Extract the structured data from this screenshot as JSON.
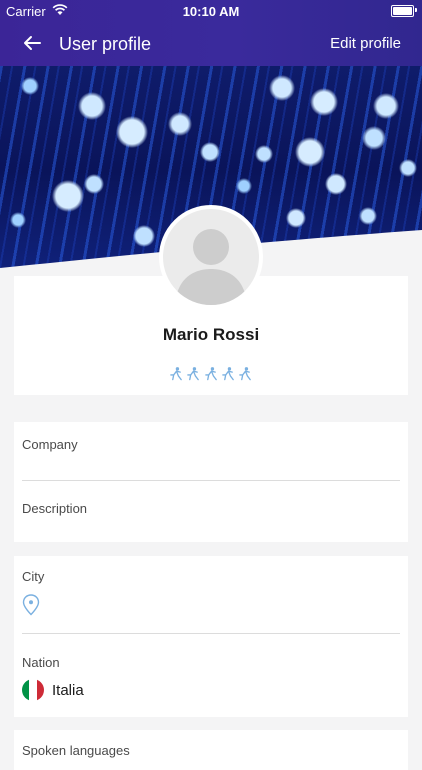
{
  "status_bar": {
    "carrier": "Carrier",
    "time": "10:10 AM"
  },
  "app_bar": {
    "title": "User profile",
    "edit_label": "Edit profile",
    "back_icon": "arrow-left-icon",
    "background": "#3a2a9c"
  },
  "profile": {
    "name": "Mario Rossi",
    "skill_icon_count": 5,
    "skill_icon": "sport-figure-icon",
    "skill_icon_color": "#7ab0e0"
  },
  "fields": {
    "company_label": "Company",
    "description_label": "Description",
    "city_label": "City",
    "city_icon": "location-pin-icon",
    "nation_label": "Nation",
    "nation_value": "Italia",
    "nation_flag_colors": [
      "#009246",
      "#ffffff",
      "#ce2b37"
    ],
    "spoken_languages_label": "Spoken languages"
  }
}
